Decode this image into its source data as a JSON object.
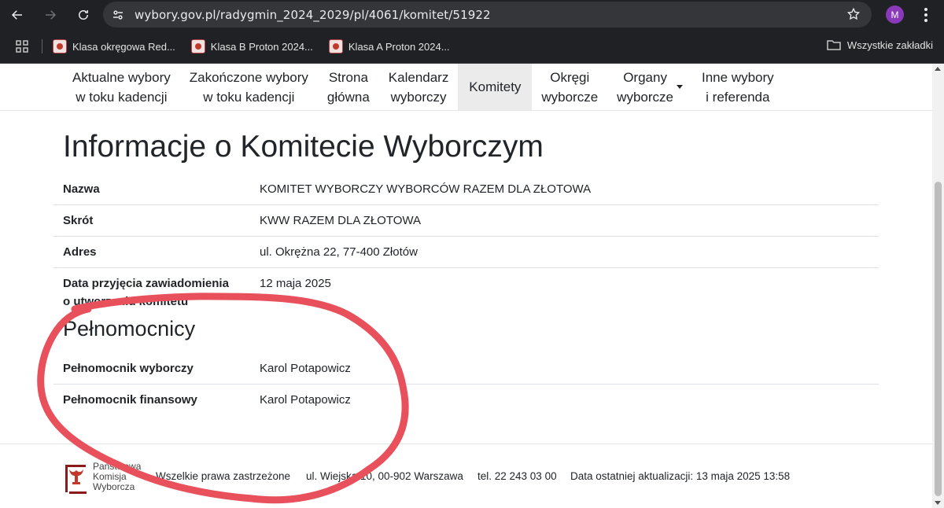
{
  "browser": {
    "url": "wybory.gov.pl/radygmin_2024_2029/pl/4061/komitet/51922",
    "avatar_letter": "M",
    "bookmarks": [
      {
        "label": "Klasa okręgowa Red..."
      },
      {
        "label": "Klasa B Proton 2024..."
      },
      {
        "label": "Klasa A Proton 2024..."
      }
    ],
    "all_bookmarks": "Wszystkie zakładki"
  },
  "nav": {
    "items": [
      {
        "line1": "Aktualne wybory",
        "line2": "w toku kadencji"
      },
      {
        "line1": "Zakończone wybory",
        "line2": "w toku kadencji"
      },
      {
        "line1": "Strona",
        "line2": "główna"
      },
      {
        "line1": "Kalendarz",
        "line2": "wyborczy"
      },
      {
        "line1": "Komitety",
        "line2": ""
      },
      {
        "line1": "Okręgi",
        "line2": "wyborcze"
      },
      {
        "line1": "Organy",
        "line2": "wyborcze"
      },
      {
        "line1": "Inne wybory",
        "line2": "i referenda"
      }
    ]
  },
  "committee": {
    "title": "Informacje o Komitecie Wyborczym",
    "rows": [
      {
        "label": "Nazwa",
        "value": "KOMITET WYBORCZY WYBORCÓW RAZEM DLA ZŁOTOWA"
      },
      {
        "label": "Skrót",
        "value": "KWW RAZEM DLA ZŁOTOWA"
      },
      {
        "label": "Adres",
        "value": "ul. Okrężna 22, 77-400 Złotów"
      },
      {
        "label_line1": "Data przyjęcia zawiadomienia",
        "label_line2": "o utworzeniu komitetu",
        "value": "12 maja 2025"
      }
    ]
  },
  "proxies": {
    "title": "Pełnomocnicy",
    "rows": [
      {
        "label": "Pełnomocnik wyborczy",
        "value": "Karol Potapowicz"
      },
      {
        "label": "Pełnomocnik finansowy",
        "value": "Karol Potapowicz"
      }
    ]
  },
  "footer": {
    "logo_line1": "Państwowa",
    "logo_line2": "Komisja",
    "logo_line3": "Wyborcza",
    "rights": "Wszelkie prawa zastrzeżone",
    "address": "ul. Wiejska 10, 00-902 Warszawa",
    "phone": "tel. 22 243 03 00",
    "updated": "Data ostatniej aktualizacji: 13 maja 2025 13:58"
  },
  "colors": {
    "annotation": "#e8505b",
    "chrome": "#202124",
    "active_tab": "#ebebeb"
  }
}
